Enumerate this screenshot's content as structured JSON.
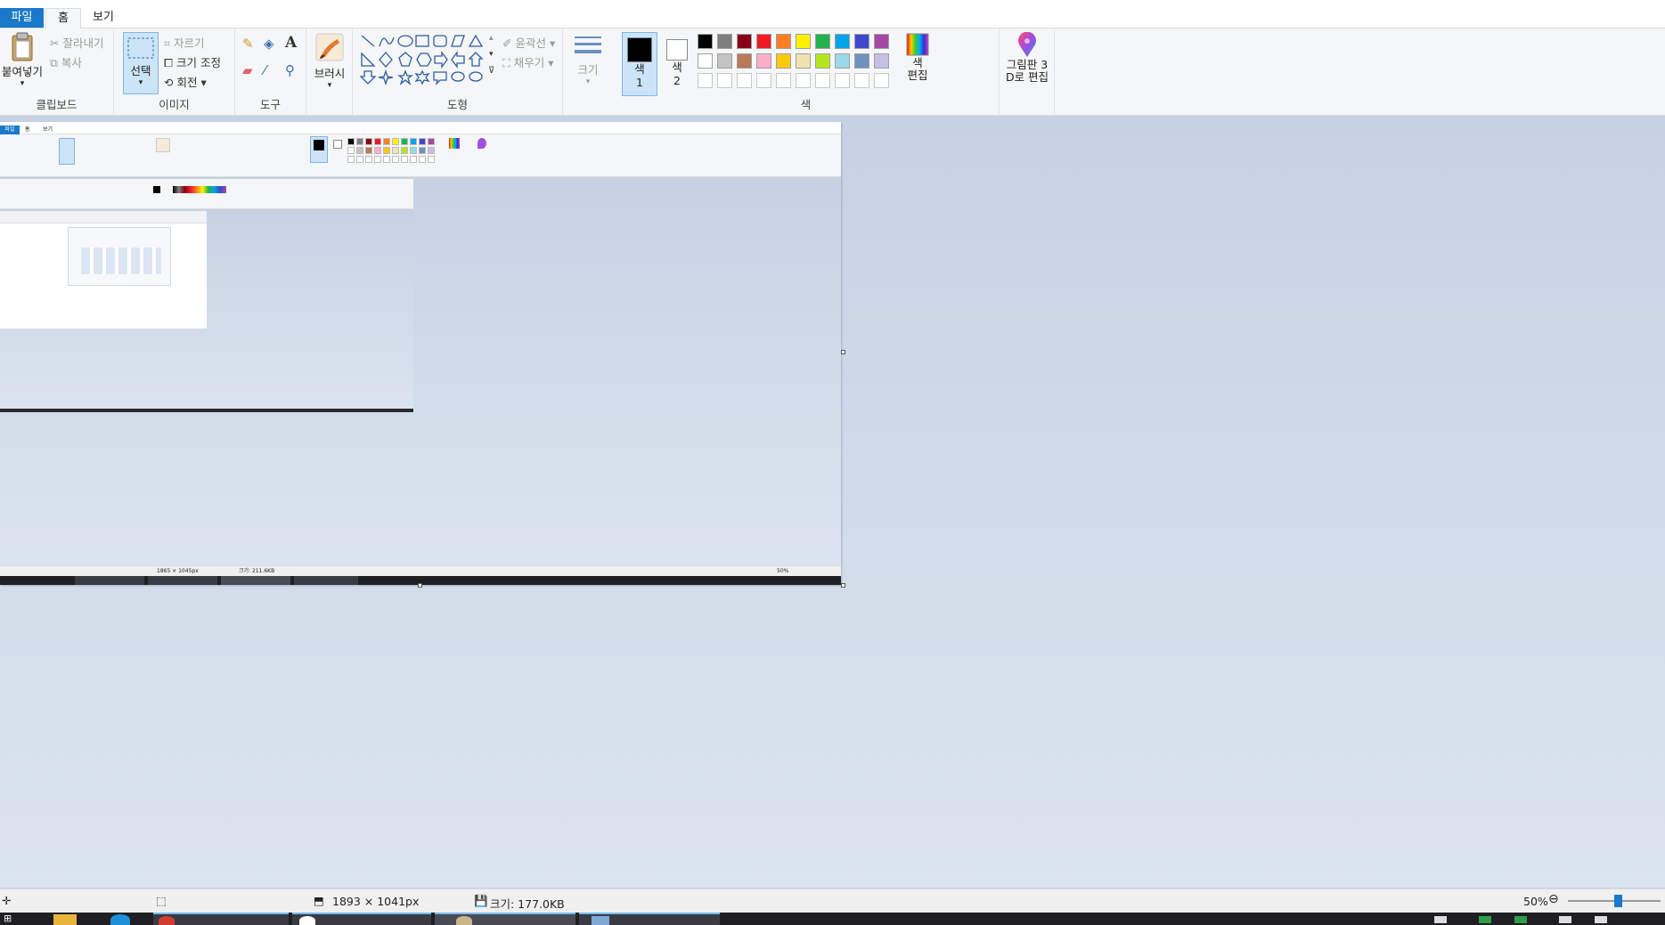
{
  "tabs": {
    "file": "파일",
    "home": "홈",
    "view": "보기"
  },
  "clipboard": {
    "paste": "붙여넣기",
    "cut": "잘라내기",
    "copy": "복사",
    "label": "클립보드"
  },
  "image": {
    "select": "선택",
    "crop": "자르기",
    "resize": "크기 조정",
    "rotate": "회전",
    "label": "이미지"
  },
  "tools": {
    "label": "도구"
  },
  "brushes": {
    "label": "브러시"
  },
  "shapes": {
    "outline": "윤곽선",
    "fill": "채우기",
    "label": "도형"
  },
  "size": {
    "label": "크기"
  },
  "colors": {
    "color1": "색\n1",
    "color2": "색\n2",
    "edit": "색\n편집",
    "label": "색",
    "palette_row1": [
      "#000000",
      "#7f7f7f",
      "#880015",
      "#ed1c24",
      "#ff7f27",
      "#fff200",
      "#22b14c",
      "#00a2e8",
      "#3f48cc",
      "#a349a4"
    ],
    "palette_row2": [
      "#ffffff",
      "#c3c3c3",
      "#b97a57",
      "#ffaec9",
      "#ffc90e",
      "#efe4b0",
      "#b5e61d",
      "#99d9ea",
      "#7092be",
      "#c8bfe7"
    ]
  },
  "paint3d": {
    "label": "그림판 3\nD로 편집"
  },
  "status": {
    "dimensions": "1893 × 1041px",
    "size": "크기: 177.0KB",
    "zoom": "50%"
  },
  "nested": {
    "tabs": {
      "file": "파일",
      "home": "홈",
      "view": "보기"
    },
    "status_dims": "1865 × 1045px",
    "status_size": "크기: 211.6KB",
    "zoom": "50%"
  }
}
